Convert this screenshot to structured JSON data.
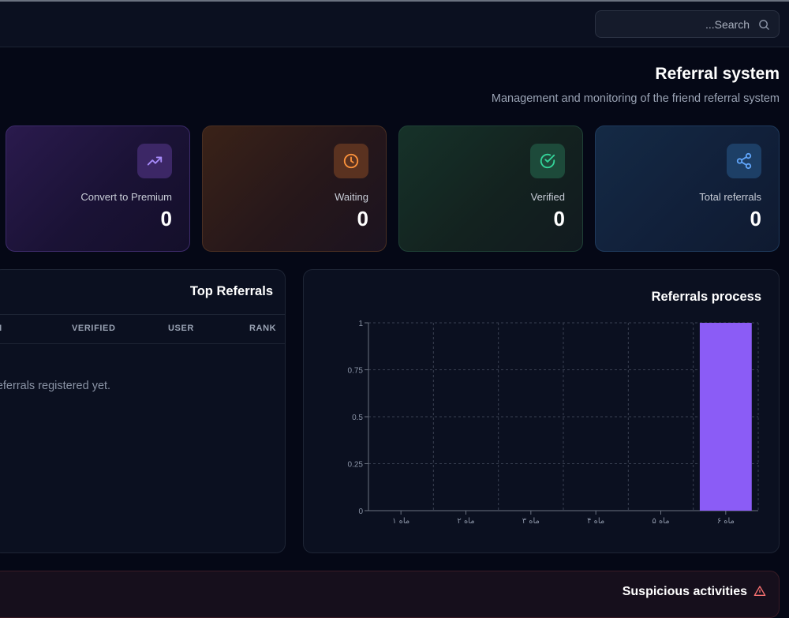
{
  "header": {
    "search_placeholder": "...Search",
    "search_icon": "search-icon"
  },
  "page": {
    "title": "Referral system",
    "subtitle": "Management and monitoring of the friend referral system"
  },
  "stats": [
    {
      "label": "Convert to Premium",
      "value": "0",
      "icon": "trending-up-icon",
      "accent": "#a78bfa"
    },
    {
      "label": "Waiting",
      "value": "0",
      "icon": "clock-icon",
      "accent": "#fb923c"
    },
    {
      "label": "Verified",
      "value": "0",
      "icon": "check-circle-icon",
      "accent": "#34d399"
    },
    {
      "label": "Total referrals",
      "value": "0",
      "icon": "share-icon",
      "accent": "#60a5fa"
    }
  ],
  "top_referrals": {
    "title": "Top Referrals",
    "columns": [
      "M",
      "VERIFIED",
      "USER",
      "RANK"
    ],
    "empty_text": "referrals registered yet."
  },
  "referrals_process": {
    "title": "Referrals process"
  },
  "chart_data": {
    "type": "bar",
    "categories": [
      "ماه ۱",
      "ماه ۲",
      "ماه ۳",
      "ماه ۴",
      "ماه ۵",
      "ماه ۶"
    ],
    "values": [
      0,
      0,
      0,
      0,
      0,
      1
    ],
    "yticks": [
      "0",
      "0.25",
      "0.5",
      "0.75",
      "1"
    ],
    "ylim": [
      0,
      1
    ],
    "grid": true,
    "bar_color": "#8b5cf6"
  },
  "suspicious": {
    "title": "Suspicious activities",
    "icon": "warning-icon"
  }
}
